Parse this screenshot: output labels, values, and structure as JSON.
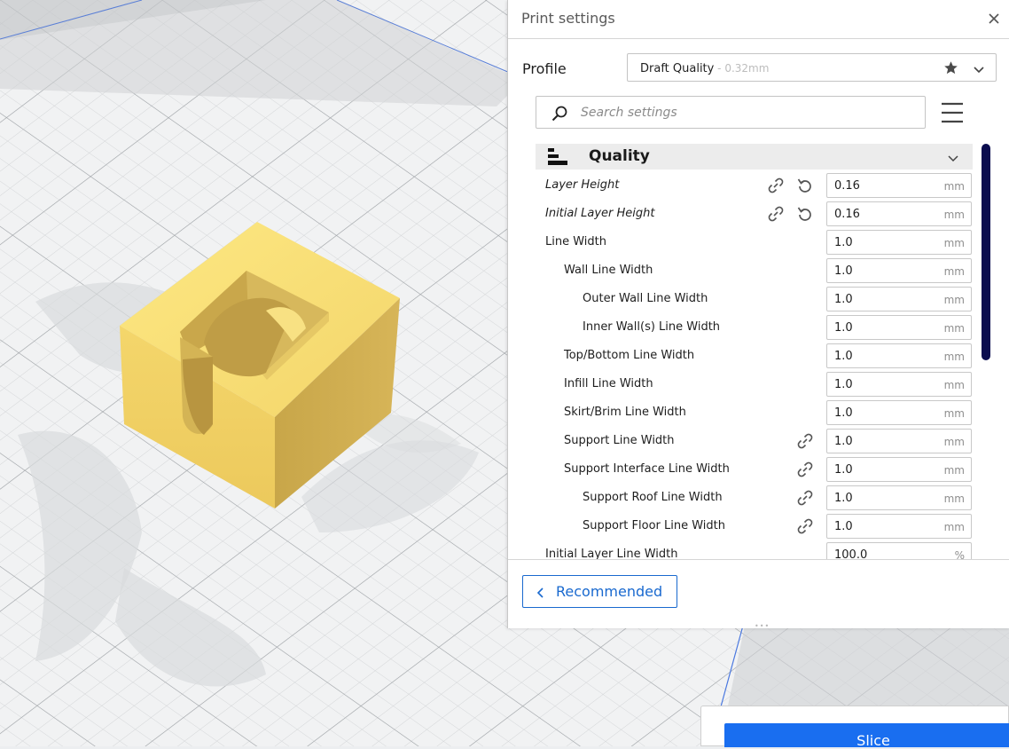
{
  "panel": {
    "title": "Print settings",
    "close_icon": "close-icon"
  },
  "profile": {
    "label": "Profile",
    "selected": "Draft Quality",
    "selected_suffix": " - 0.32mm"
  },
  "search": {
    "placeholder": "Search settings",
    "value": ""
  },
  "category": {
    "label": "Quality",
    "icon": "quality-bars-icon"
  },
  "settings": [
    {
      "label": "Layer Height",
      "value": "0.16",
      "unit": "mm",
      "italic": true
    },
    {
      "label": "Initial Layer Height",
      "value": "0.16",
      "unit": "mm",
      "italic": true
    },
    {
      "label": "Line Width",
      "value": "1.0",
      "unit": "mm"
    },
    {
      "label": "Wall Line Width",
      "value": "1.0",
      "unit": "mm"
    },
    {
      "label": "Outer Wall Line Width",
      "value": "1.0",
      "unit": "mm"
    },
    {
      "label": "Inner Wall(s) Line Width",
      "value": "1.0",
      "unit": "mm"
    },
    {
      "label": "Top/Bottom Line Width",
      "value": "1.0",
      "unit": "mm"
    },
    {
      "label": "Infill Line Width",
      "value": "1.0",
      "unit": "mm"
    },
    {
      "label": "Skirt/Brim Line Width",
      "value": "1.0",
      "unit": "mm"
    },
    {
      "label": "Support Line Width",
      "value": "1.0",
      "unit": "mm"
    },
    {
      "label": "Support Interface Line Width",
      "value": "1.0",
      "unit": "mm"
    },
    {
      "label": "Support Roof Line Width",
      "value": "1.0",
      "unit": "mm"
    },
    {
      "label": "Support Floor Line Width",
      "value": "1.0",
      "unit": "mm"
    },
    {
      "label": "Initial Layer Line Width",
      "value": "100.0",
      "unit": "%"
    }
  ],
  "footer": {
    "recommended_label": "Recommended",
    "drag_handle": "•••"
  },
  "slice": {
    "label": "Slice"
  },
  "colors": {
    "accent": "#1969cf",
    "slice_button": "#196ef0",
    "scrollbar": "#0b0d4f",
    "model": "#f5d76e",
    "build_plate": "#f2f3f4"
  }
}
